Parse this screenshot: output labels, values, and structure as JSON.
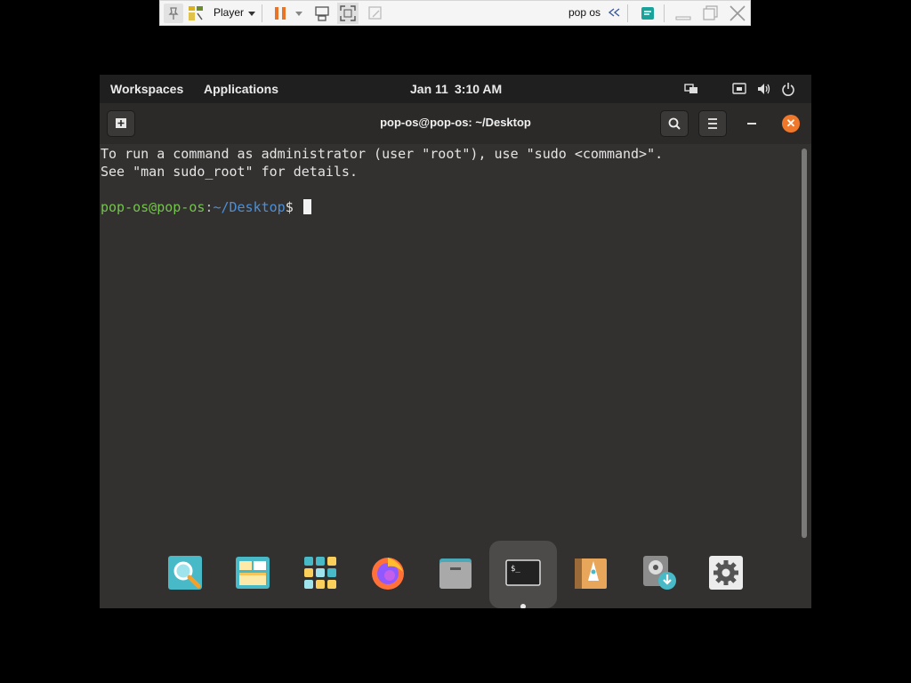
{
  "player_toolbar": {
    "player_label": "Player",
    "vm_name": "pop os",
    "icons": [
      "pin-icon",
      "library-icon",
      "pause-icon",
      "send-ctrl-alt-del-icon",
      "fullscreen-icon",
      "unity-icon",
      "chevrons-left-icon",
      "notes-icon",
      "minimize-icon",
      "restore-icon",
      "close-icon"
    ]
  },
  "top_panel": {
    "workspaces": "Workspaces",
    "applications": "Applications",
    "date": "Jan 11",
    "time": "3:10 AM",
    "icons": [
      "network-wired-icon",
      "display-icon",
      "volume-icon",
      "power-icon"
    ]
  },
  "window": {
    "title": "pop-os@pop-os: ~/Desktop",
    "close_glyph": "✕"
  },
  "terminal": {
    "line1": "To run a command as administrator (user \"root\"), use \"sudo <command>\".",
    "line2": "See \"man sudo_root\" for details.",
    "prompt_user": "pop-os@pop-os",
    "prompt_colon": ":",
    "prompt_path": "~/Desktop",
    "prompt_symbol": "$ "
  },
  "dock": {
    "items": [
      {
        "name": "search-app-icon"
      },
      {
        "name": "workspaces-app-icon"
      },
      {
        "name": "applications-grid-icon"
      },
      {
        "name": "firefox-icon"
      },
      {
        "name": "files-icon"
      },
      {
        "name": "terminal-app-icon",
        "label": "$_",
        "active": true
      },
      {
        "name": "pop-shop-icon"
      },
      {
        "name": "installer-icon"
      },
      {
        "name": "settings-icon"
      }
    ]
  },
  "colors": {
    "accent": "#f0782a",
    "prompt_user": "#73c44a",
    "prompt_path": "#4a90d9",
    "terminal_bg": "#333130"
  }
}
